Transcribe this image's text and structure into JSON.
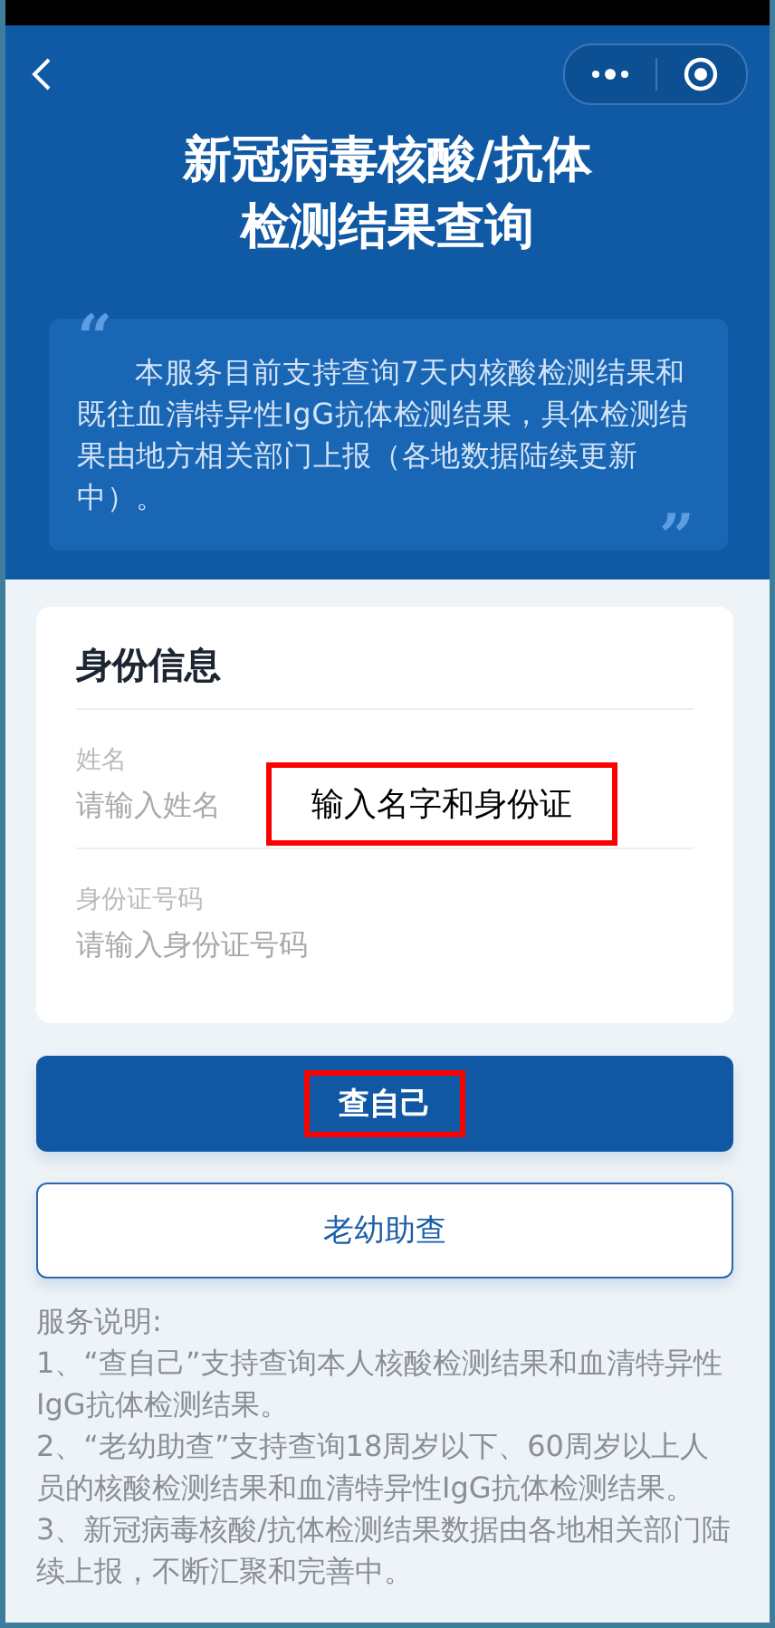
{
  "header": {
    "title_lines": [
      "新冠病毒核酸/抗体",
      "检测结果查询"
    ],
    "open_quote": "“",
    "close_quote": "”",
    "intro": "本服务目前支持查询7天内核酸检测结果和既往血清特异性IgG抗体检测结果，具体检测结果由地方相关部门上报（各地数据陆续更新中）。"
  },
  "form": {
    "title": "身份信息",
    "fields": [
      {
        "label": "姓名",
        "placeholder": "请输入姓名"
      },
      {
        "label": "身份证号码",
        "placeholder": "请输入身份证号码"
      }
    ]
  },
  "callout": {
    "text": "输入名字和身份证"
  },
  "buttons": [
    {
      "label": "查自己",
      "kind": "primary",
      "highlighted": true
    },
    {
      "label": "老幼助查",
      "kind": "outline",
      "highlighted": false
    }
  ],
  "notes": [
    "服务说明:",
    "1、“查自己”支持查询本人核酸检测结果和血清特异性IgG抗体检测结果。",
    "2、“老幼助查”支持查询18周岁以下、60周岁以上人员的核酸检测结果和血清特异性IgG抗体检测结果。",
    "3、新冠病毒核酸/抗体检测结果数据由各地相关部门陆续上报，不断汇聚和完善中。"
  ]
}
